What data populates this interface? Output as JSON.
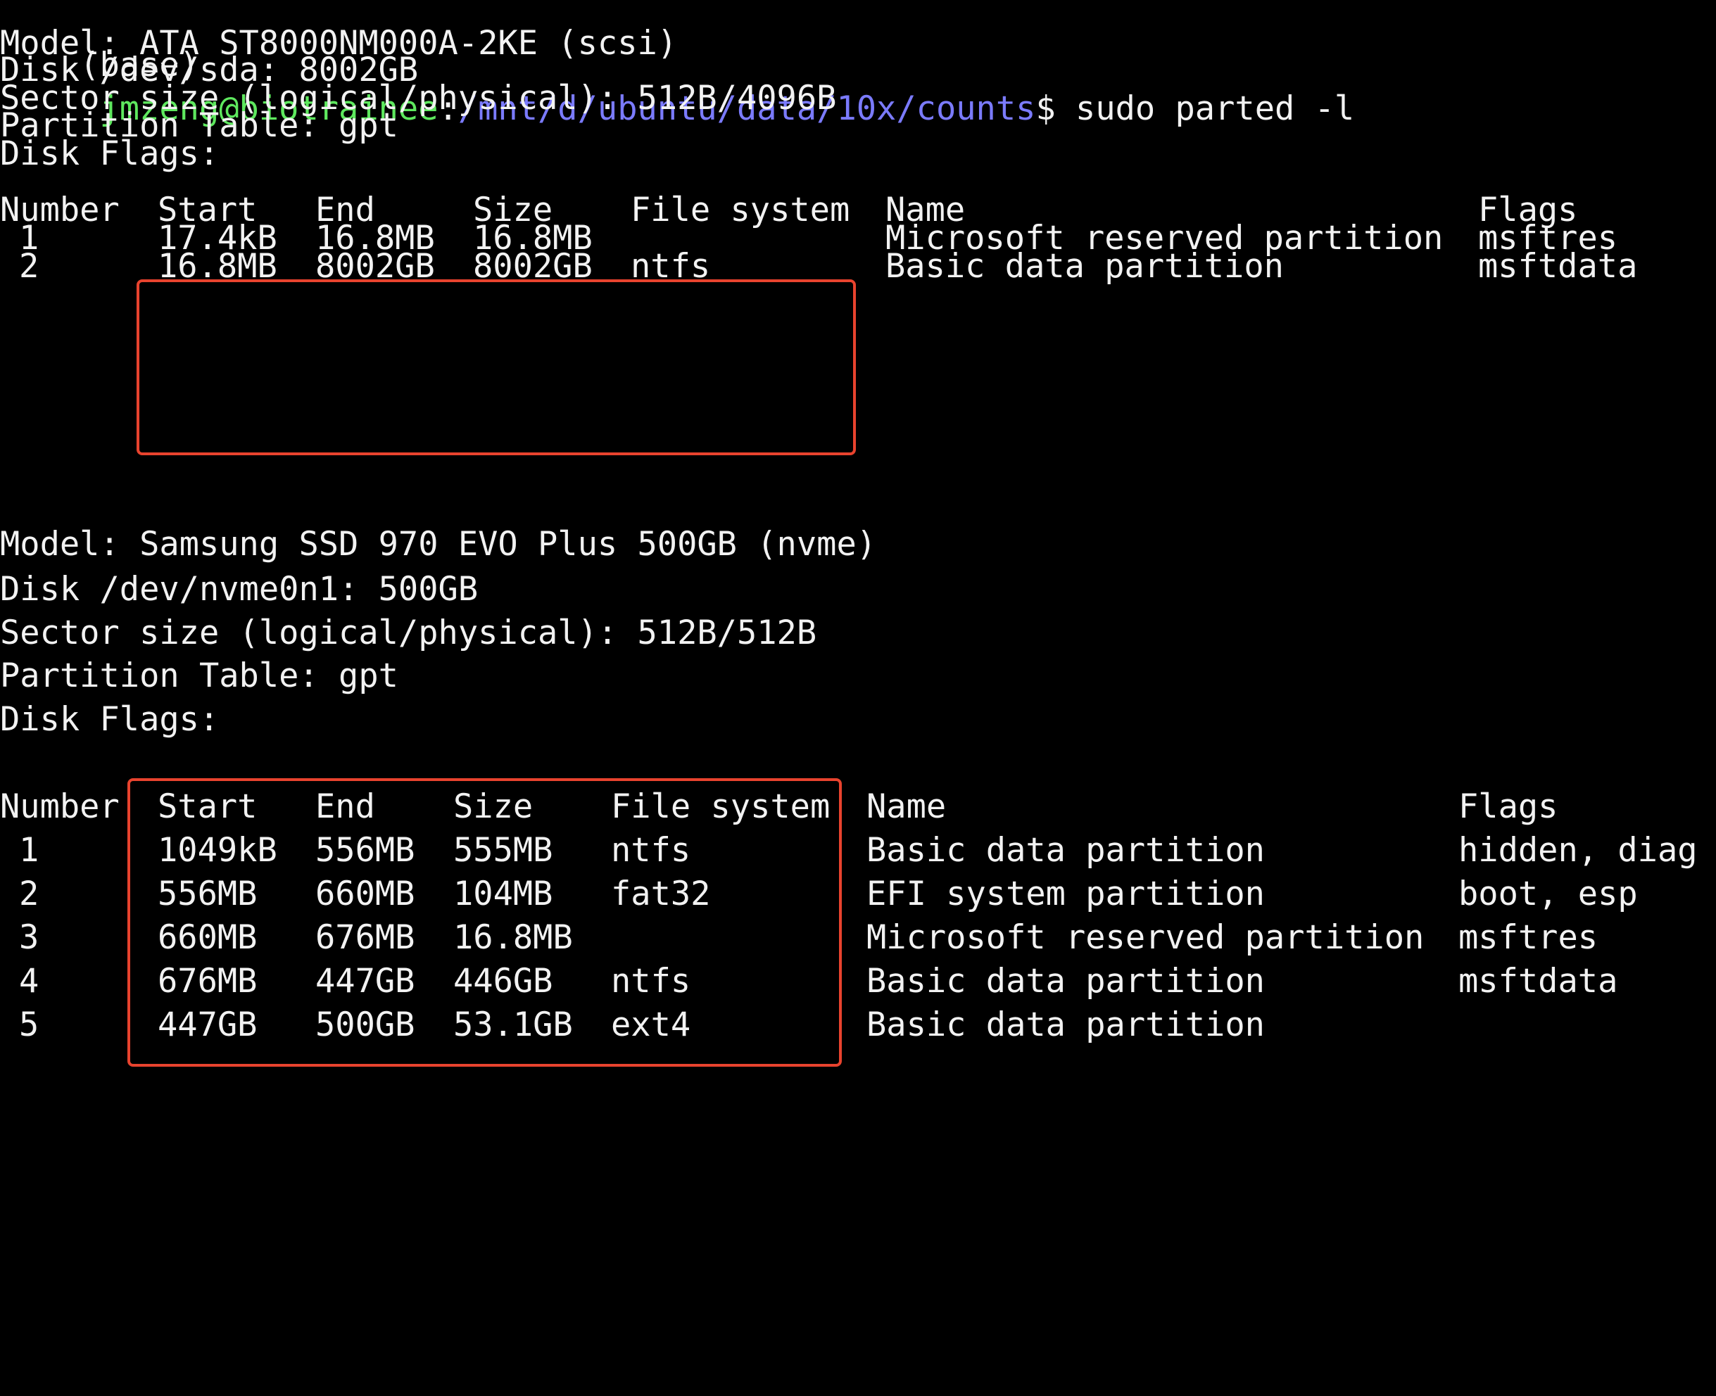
{
  "prompt": {
    "env": "(base)",
    "user_host": "jmzeng@biotrainee",
    "separator": ":",
    "cwd": "/mnt/d/ubuntu/data/10x/counts",
    "symbol": "$",
    "command": " sudo parted -l"
  },
  "disks": [
    {
      "model": "Model: ATA ST8000NM000A-2KE (scsi)",
      "disk": "Disk /dev/sda: 8002GB",
      "sector": "Sector size (logical/physical): 512B/4096B",
      "table": "Partition Table: gpt",
      "flags": "Disk Flags:",
      "headers": {
        "number": "Number",
        "start": "Start",
        "end": "End",
        "size": "Size",
        "fs": "File system",
        "name": "Name",
        "flags": "Flags"
      },
      "partitions": [
        {
          "number": "1",
          "start": "17.4kB",
          "end": "16.8MB",
          "size": "16.8MB",
          "fs": "",
          "name": "Microsoft reserved partition",
          "flags": "msftres"
        },
        {
          "number": "2",
          "start": "16.8MB",
          "end": "8002GB",
          "size": "8002GB",
          "fs": "ntfs",
          "name": "Basic data partition",
          "flags": "msftdata"
        }
      ]
    },
    {
      "model": "Model: Samsung SSD 970 EVO Plus 500GB (nvme)",
      "disk": "Disk /dev/nvme0n1: 500GB",
      "sector": "Sector size (logical/physical): 512B/512B",
      "table": "Partition Table: gpt",
      "flags": "Disk Flags:",
      "headers": {
        "number": "Number",
        "start": "Start",
        "end": "End",
        "size": "Size",
        "fs": "File system",
        "name": "Name",
        "flags": "Flags"
      },
      "partitions": [
        {
          "number": "1",
          "start": "1049kB",
          "end": "556MB",
          "size": "555MB",
          "fs": "ntfs",
          "name": "Basic data partition",
          "flags": "hidden, diag"
        },
        {
          "number": "2",
          "start": "556MB",
          "end": "660MB",
          "size": "104MB",
          "fs": "fat32",
          "name": "EFI system partition",
          "flags": "boot, esp"
        },
        {
          "number": "3",
          "start": "660MB",
          "end": "676MB",
          "size": "16.8MB",
          "fs": "",
          "name": "Microsoft reserved partition",
          "flags": "msftres"
        },
        {
          "number": "4",
          "start": "676MB",
          "end": "447GB",
          "size": "446GB",
          "fs": "ntfs",
          "name": "Basic data partition",
          "flags": "msftdata"
        },
        {
          "number": "5",
          "start": "447GB",
          "end": "500GB",
          "size": "53.1GB",
          "fs": "ext4",
          "name": "Basic data partition",
          "flags": ""
        }
      ]
    }
  ],
  "colors": {
    "background": "#000000",
    "text": "#f2f2f2",
    "user_host": "#5ee85e",
    "path": "#7b7bff",
    "highlight_box": "#e8432e"
  }
}
